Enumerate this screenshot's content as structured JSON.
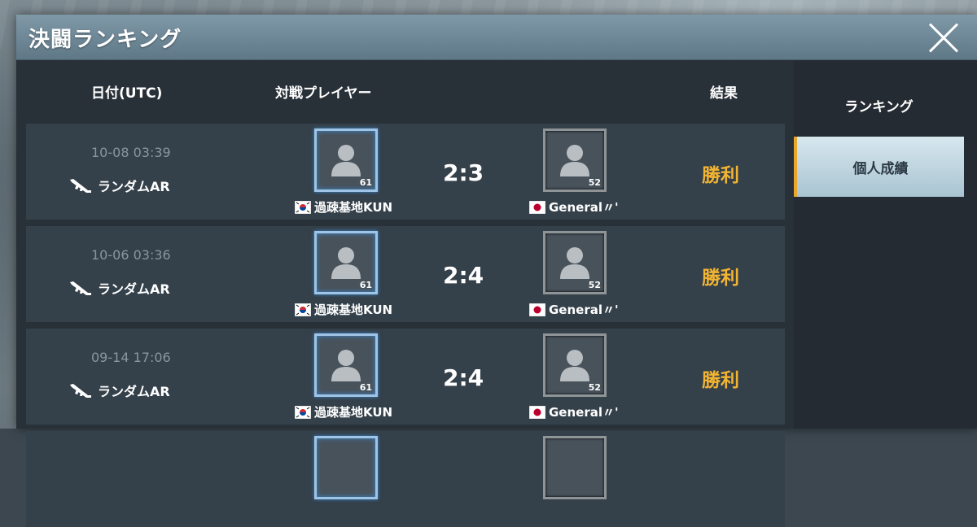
{
  "window": {
    "title": "決闘ランキング"
  },
  "columns": {
    "date": "日付(UTC)",
    "opponent": "対戦プレイヤー",
    "result": "結果"
  },
  "sidebar": {
    "tabs": [
      {
        "label": "ランキング",
        "active": false
      },
      {
        "label": "個人成績",
        "active": true
      }
    ]
  },
  "matches": [
    {
      "date": "10-08 03:39",
      "mode": "ランダムAR",
      "player": {
        "name": "過疎基地KUN",
        "level": "61",
        "flag": "korea-flag-icon"
      },
      "opponent": {
        "name": "General〃'",
        "level": "52",
        "flag": "japan-flag-icon"
      },
      "score": "2:3",
      "result": "勝利"
    },
    {
      "date": "10-06 03:36",
      "mode": "ランダムAR",
      "player": {
        "name": "過疎基地KUN",
        "level": "61",
        "flag": "korea-flag-icon"
      },
      "opponent": {
        "name": "General〃'",
        "level": "52",
        "flag": "japan-flag-icon"
      },
      "score": "2:4",
      "result": "勝利"
    },
    {
      "date": "09-14 17:06",
      "mode": "ランダムAR",
      "player": {
        "name": "過疎基地KUN",
        "level": "61",
        "flag": "korea-flag-icon"
      },
      "opponent": {
        "name": "General〃'",
        "level": "52",
        "flag": "japan-flag-icon"
      },
      "score": "2:4",
      "result": "勝利"
    }
  ],
  "colors": {
    "result": "#f2b431",
    "active_tab_accent": "#e9a82a",
    "titlebar": "#6f8897"
  }
}
